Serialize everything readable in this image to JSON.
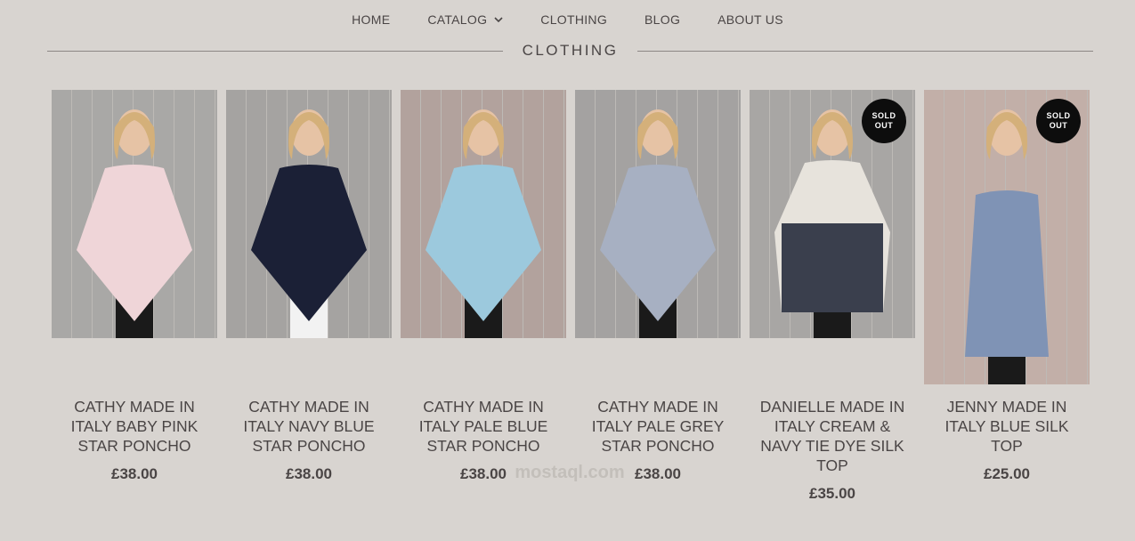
{
  "nav": {
    "items": [
      {
        "label": "HOME",
        "name": "nav-home"
      },
      {
        "label": "CATALOG",
        "name": "nav-catalog",
        "dropdown": true
      },
      {
        "label": "CLOTHING",
        "name": "nav-clothing"
      },
      {
        "label": "BLOG",
        "name": "nav-blog"
      },
      {
        "label": "ABOUT US",
        "name": "nav-about-us"
      }
    ]
  },
  "section": {
    "title": "CLOTHING"
  },
  "badge_label": "SOLD OUT",
  "colors": {
    "background": "#d8d4d0",
    "text": "#4a4545",
    "badge": "#0d0d0d"
  },
  "products": [
    {
      "name": "CATHY MADE IN ITALY BABY PINK STAR PONCHO",
      "price": "£38.00",
      "sold_out": false,
      "garment_color": "#efd5d8",
      "backdrop": "#a9a8a6"
    },
    {
      "name": "CATHY MADE IN ITALY NAVY BLUE STAR PONCHO",
      "price": "£38.00",
      "sold_out": false,
      "garment_color": "#1b2036",
      "backdrop": "#a5a3a1"
    },
    {
      "name": "CATHY MADE IN ITALY PALE BLUE STAR PONCHO",
      "price": "£38.00",
      "sold_out": false,
      "garment_color": "#9cc9dd",
      "backdrop": "#b2a29d"
    },
    {
      "name": "CATHY MADE IN ITALY PALE GREY STAR PONCHO",
      "price": "£38.00",
      "sold_out": false,
      "garment_color": "#a7b0c2",
      "backdrop": "#a4a2a1"
    },
    {
      "name": "DANIELLE MADE IN ITALY CREAM & NAVY TIE DYE SILK TOP",
      "price": "£35.00",
      "sold_out": true,
      "garment_color": "#3a3f4d",
      "backdrop": "#a8a6a4"
    },
    {
      "name": "JENNY MADE IN ITALY BLUE SILK TOP",
      "price": "£25.00",
      "sold_out": true,
      "garment_color": "#7f93b5",
      "backdrop": "#c2afa8"
    }
  ]
}
